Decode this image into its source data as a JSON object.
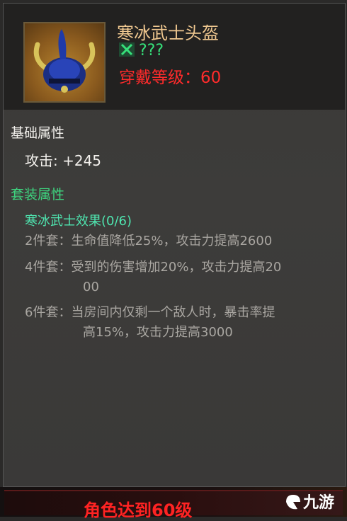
{
  "item": {
    "name": "寒冰武士头盔",
    "quality": "???",
    "required_level": "穿戴等级：60",
    "icon": "blue-horned-helmet-icon"
  },
  "base_attributes": {
    "heading": "基础属性",
    "attack": "攻击: +245"
  },
  "set_bonus": {
    "heading": "套装属性",
    "effect_title": "寒冰武士效果(0/6)",
    "pieces": [
      {
        "lines": [
          "2件套：生命值降低25%，攻击力提高2600"
        ]
      },
      {
        "lines": [
          "4件套：受到的伤害增加20%，攻击力提高20",
          "00"
        ]
      },
      {
        "lines": [
          "6件套：当房间内仅剩一个敌人时，暴击率提",
          "高15%，攻击力提高3000"
        ]
      }
    ]
  },
  "bottom_notice": "角色达到60级",
  "watermark": "九游",
  "colors": {
    "title": "#f0c890",
    "quality": "#36e07a",
    "required_level": "#ff2b2b",
    "set_heading": "#3ed47f",
    "effect_title": "#4fe6b0",
    "set_lines": "#a9a6a1"
  }
}
